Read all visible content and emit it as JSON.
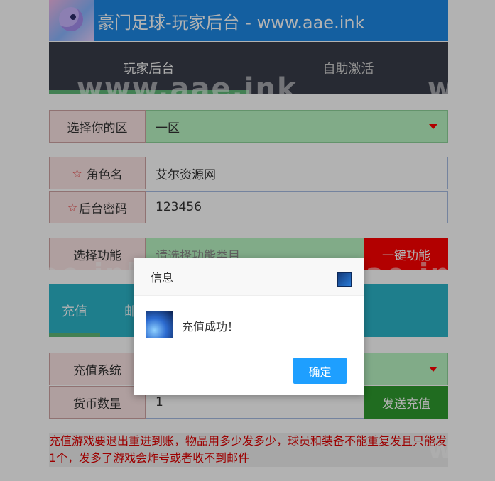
{
  "header": {
    "title": "豪门足球-玩家后台 - www.aae.ink"
  },
  "nav": {
    "tabs": [
      "玩家后台",
      "自助激活"
    ]
  },
  "form": {
    "zone": {
      "label": "选择你的区",
      "value": "一区"
    },
    "role": {
      "label": "角色名",
      "value": "艾尔资源网"
    },
    "password": {
      "label": "后台密码",
      "value": "123456"
    },
    "feature": {
      "label": "选择功能",
      "placeholder": "请选择功能类目",
      "button": "一键功能"
    }
  },
  "tabs": {
    "items": [
      "充值",
      "邮件"
    ]
  },
  "recharge": {
    "system": {
      "label": "充值系统"
    },
    "amount": {
      "label": "货币数量",
      "value": "1",
      "button": "发送充值"
    }
  },
  "note": {
    "text": "充值游戏要退出重进到账，物品用多少发多少，球员和装备不能重复发且只能发1个，发多了游戏会炸号或者收不到邮件"
  },
  "watermark": {
    "text": "www.aae.ink"
  },
  "dialog": {
    "title": "信息",
    "message": "充值成功！",
    "ok_label": "确定"
  },
  "colors": {
    "accent": "#1e88e5",
    "nav_bg": "#393d49",
    "danger": "#ff0000",
    "success": "#2e9b2e",
    "primary_button": "#1e9fff"
  },
  "icons": {
    "close": "close-icon",
    "message": "success-icon",
    "dropdown": "caret-down-icon"
  }
}
